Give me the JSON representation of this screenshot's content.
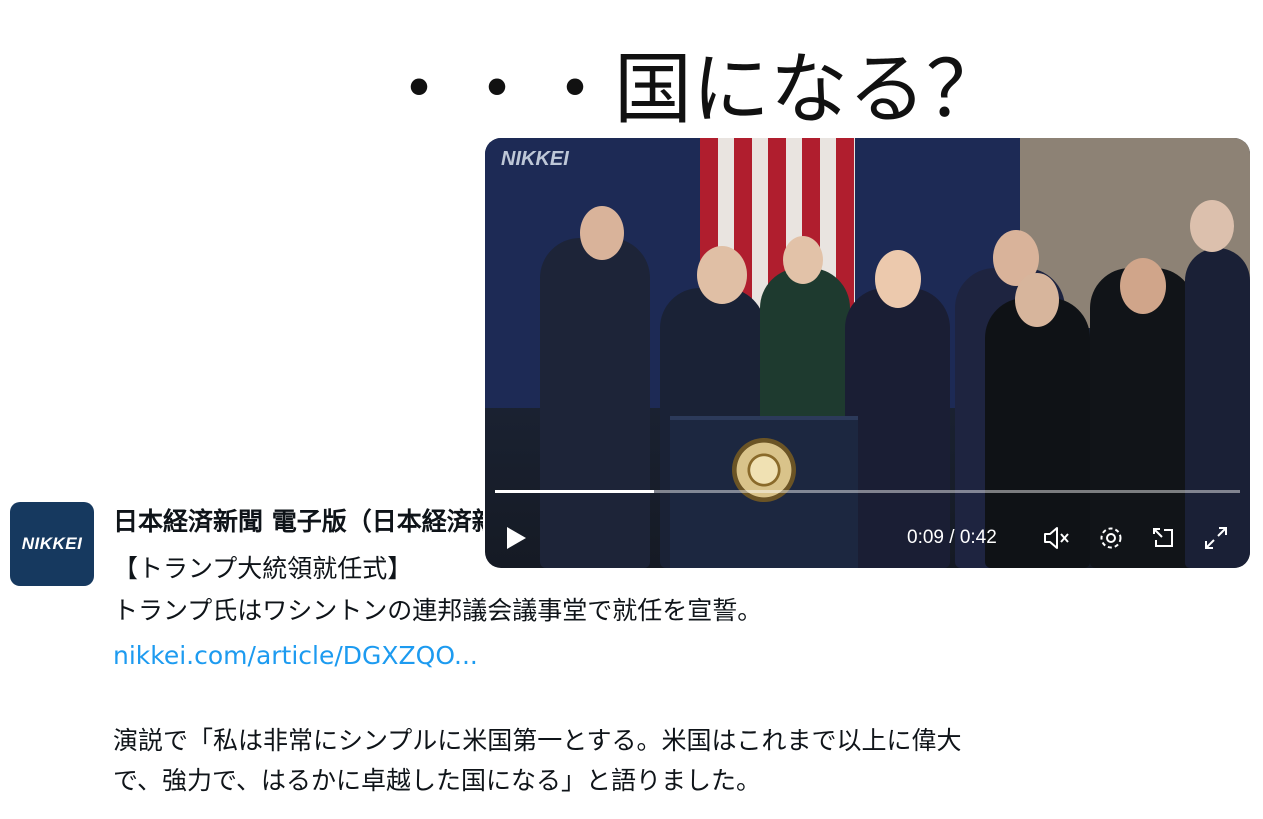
{
  "headline": "・・・国になる？",
  "post": {
    "avatar_text": "NIKKEI",
    "author": "日本経済新聞 電子版（日本経済新聞社）",
    "line1": "【トランプ大統領就任式】",
    "line2": "トランプ氏はワシントンの連邦議会議事堂で就任を宣誓。",
    "link": "nikkei.com/article/DGXZQO...",
    "line4": "演説で「私は非常にシンプルに米国第一とする。米国はこれまで以上に偉大",
    "line5": "で、強力で、はるかに卓越した国になる」と語りました。"
  },
  "video": {
    "watermark": "NIKKEI",
    "time": "0:09 / 0:42",
    "progress": 0.214,
    "controls": [
      "play-icon",
      "mute-icon",
      "gear-icon",
      "popout-icon",
      "fullscreen-icon"
    ]
  }
}
